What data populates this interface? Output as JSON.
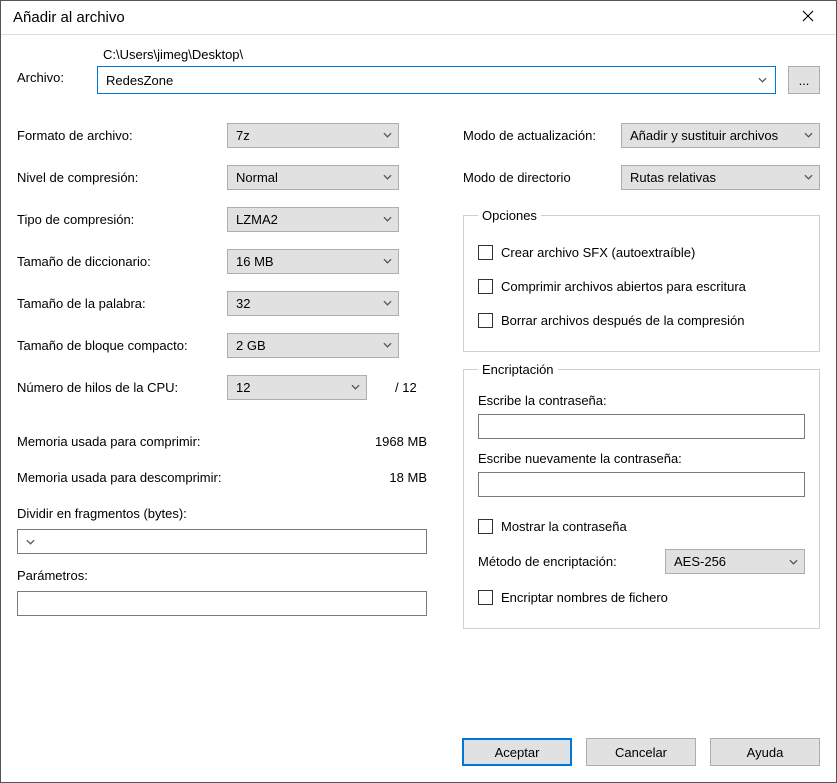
{
  "title": "Añadir al archivo",
  "archive": {
    "label": "Archivo:",
    "path": "C:\\Users\\jimeg\\Desktop\\",
    "value": "RedesZone",
    "browse": "..."
  },
  "left": {
    "format_label": "Formato de archivo:",
    "format_value": "7z",
    "level_label": "Nivel de compresión:",
    "level_value": "Normal",
    "method_label": "Tipo de compresión:",
    "method_value": "LZMA2",
    "dict_label": "Tamaño de diccionario:",
    "dict_value": "16 MB",
    "word_label": "Tamaño de la palabra:",
    "word_value": "32",
    "block_label": "Tamaño de bloque compacto:",
    "block_value": "2 GB",
    "threads_label": "Número de hilos de la CPU:",
    "threads_value": "12",
    "threads_max": "/ 12",
    "mem_comp_label": "Memoria usada para comprimir:",
    "mem_comp_value": "1968 MB",
    "mem_decomp_label": "Memoria usada para descomprimir:",
    "mem_decomp_value": "18 MB",
    "fragments_label": "Dividir en fragmentos (bytes):",
    "params_label": "Parámetros:"
  },
  "right": {
    "update_label": "Modo de actualización:",
    "update_value": "Añadir y sustituir archivos",
    "pathmode_label": "Modo de directorio",
    "pathmode_value": "Rutas relativas",
    "options_legend": "Opciones",
    "opt_sfx": "Crear archivo SFX (autoextraíble)",
    "opt_open": "Comprimir archivos abiertos para escritura",
    "opt_delete": "Borrar archivos después de la compresión",
    "enc_legend": "Encriptación",
    "enc_pwd1_label": "Escribe la contraseña:",
    "enc_pwd2_label": "Escribe nuevamente la contraseña:",
    "enc_show": "Mostrar la contraseña",
    "enc_method_label": "Método de encriptación:",
    "enc_method_value": "AES-256",
    "enc_names": "Encriptar nombres de fichero"
  },
  "buttons": {
    "ok": "Aceptar",
    "cancel": "Cancelar",
    "help": "Ayuda"
  }
}
